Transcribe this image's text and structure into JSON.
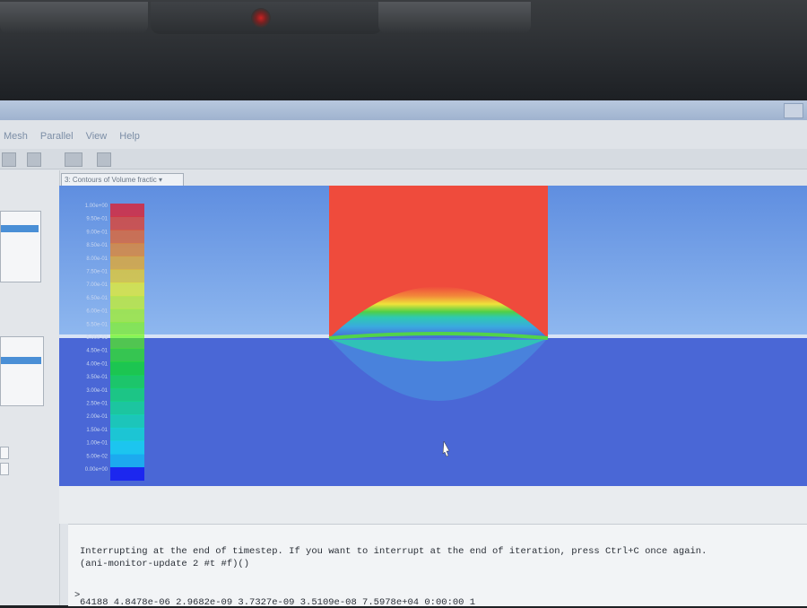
{
  "menu": {
    "items": [
      "Mesh",
      "Parallel",
      "View",
      "Help"
    ]
  },
  "viewport": {
    "dropdown_label": "3: Contours of Volume fractic"
  },
  "legend": {
    "labels": [
      "1.00e+00",
      "9.50e-01",
      "9.00e-01",
      "8.50e-01",
      "8.00e-01",
      "7.50e-01",
      "7.00e-01",
      "6.50e-01",
      "6.00e-01",
      "5.50e-01",
      "5.00e-01",
      "4.50e-01",
      "4.00e-01",
      "3.50e-01",
      "3.00e-01",
      "2.50e-01",
      "2.00e-01",
      "1.50e-01",
      "1.00e-01",
      "5.00e-02",
      "0.00e+00"
    ],
    "colors": [
      "#ff0000",
      "#ff2a00",
      "#ff5500",
      "#ff8000",
      "#ffaa00",
      "#ffd400",
      "#ffff00",
      "#d4ff00",
      "#aaff00",
      "#80ff00",
      "#55ff00",
      "#2aff00",
      "#00ff00",
      "#00ff2a",
      "#00ff55",
      "#00ff80",
      "#00ffaa",
      "#00ffd4",
      "#00ffff",
      "#00d4ff",
      "#0000ff"
    ]
  },
  "console": {
    "line1": "Interrupting at the end of timestep. If you want to interrupt at the end of iteration, press Ctrl+C once again.",
    "line2": "(ani-monitor-update 2 #t #f)()",
    "prompt": ">",
    "line3": "   64188  4.8478e-06  2.9682e-09  3.7327e-09  3.5109e-08  7.5978e+04  0:00:00     1"
  },
  "colors": {
    "water": "#4a67d6",
    "air": "#6c9ae6",
    "interface": "#ef4b3c"
  }
}
